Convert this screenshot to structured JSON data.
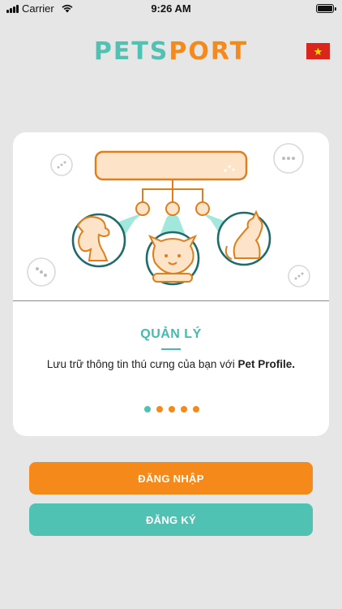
{
  "status_bar": {
    "carrier": "Carrier",
    "time": "9:26 AM",
    "icons": [
      "signal-icon",
      "wifi-icon",
      "battery-icon"
    ]
  },
  "header": {
    "logo_part1": "PETS",
    "logo_part2": "PORT",
    "language_flag": "vietnam-flag-icon"
  },
  "onboarding": {
    "title": "QUẢN LÝ",
    "description_prefix": "Lưu trữ thông tin thú cưng của bạn với ",
    "description_highlight": "Pet Profile.",
    "page_count": 5,
    "active_page": 1
  },
  "buttons": {
    "login_label": "ĐĂNG NHẬP",
    "register_label": "ĐĂNG KÝ"
  },
  "colors": {
    "teal": "#4fc2b3",
    "orange": "#f5891a",
    "background": "#e6e6e6",
    "card": "#ffffff"
  }
}
